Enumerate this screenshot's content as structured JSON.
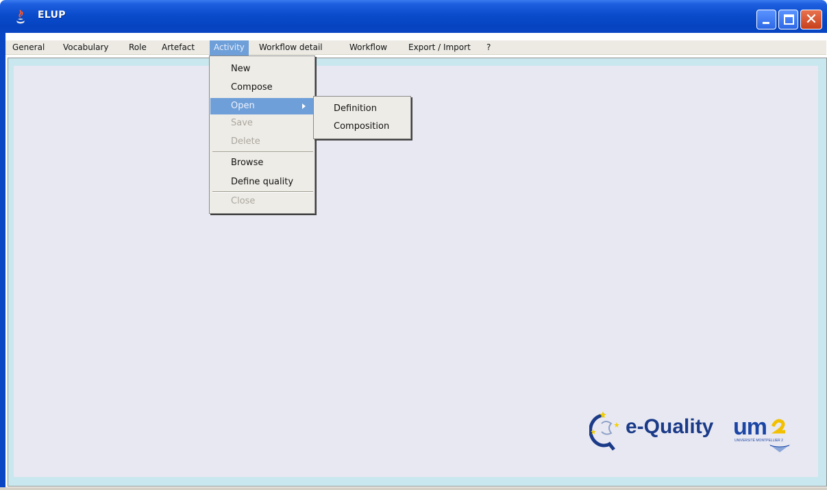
{
  "window": {
    "title": "ELUP",
    "close_glyph": "✕"
  },
  "menubar": {
    "items": [
      {
        "label": "General"
      },
      {
        "label": "Vocabulary"
      },
      {
        "label": "Role"
      },
      {
        "label": "Artefact"
      },
      {
        "label": "Activity"
      },
      {
        "label": "Workflow detail"
      },
      {
        "label": "Workflow"
      },
      {
        "label": "Export / Import"
      },
      {
        "label": "?"
      }
    ]
  },
  "activity_menu": {
    "items": [
      {
        "label": "New",
        "enabled": true
      },
      {
        "label": "Compose",
        "enabled": true
      },
      {
        "label": "Open",
        "enabled": true,
        "highlighted": true,
        "has_submenu": true
      },
      {
        "label": "Save",
        "enabled": false
      },
      {
        "label": "Delete",
        "enabled": false
      },
      {
        "label": "Browse",
        "enabled": true
      },
      {
        "label": "Define quality",
        "enabled": true
      },
      {
        "label": "Close",
        "enabled": false
      }
    ]
  },
  "open_submenu": {
    "items": [
      {
        "label": "Definition"
      },
      {
        "label": "Composition"
      }
    ]
  },
  "logos": {
    "eq_text": "e-Quality",
    "um_text": "um2",
    "um_caption": "UNIVERSITÉ MONTPELLIER 2"
  }
}
